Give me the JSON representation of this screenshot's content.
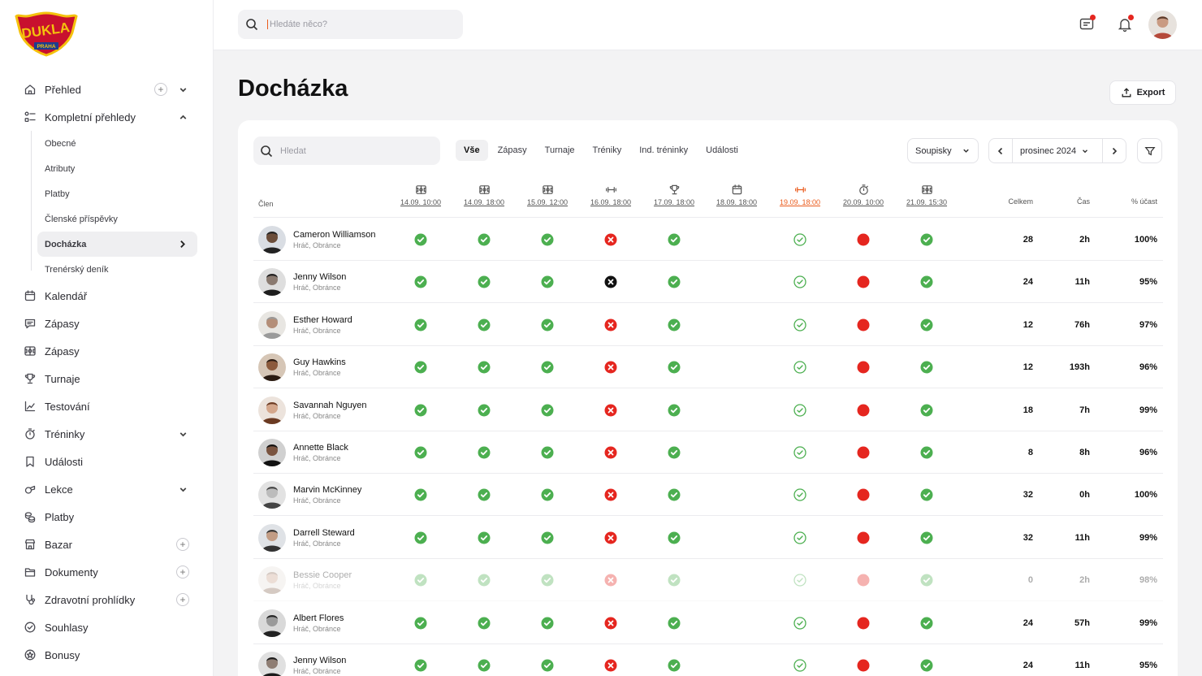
{
  "brand": {
    "logo_text": "DUKLA",
    "logo_sub": "PRAHA",
    "colors": {
      "accent": "#ea5b1c",
      "ok": "#4caf50",
      "bad": "#e5261f",
      "logo_red": "#c8102e",
      "logo_gold": "#f4c20d"
    }
  },
  "topbar": {
    "search_placeholder": "Hledáte něco?"
  },
  "sidebar": {
    "items": [
      {
        "label": "Přehled",
        "icon": "home-icon",
        "plus": true,
        "chevron": "down"
      },
      {
        "label": "Kompletní přehledy",
        "icon": "list-icon",
        "chevron": "up"
      },
      {
        "label": "Kalendář",
        "icon": "calendar-icon"
      },
      {
        "label": "Zápasy",
        "icon": "chat-icon"
      },
      {
        "label": "Zápasy",
        "icon": "pitch-icon"
      },
      {
        "label": "Turnaje",
        "icon": "trophy-icon"
      },
      {
        "label": "Testování",
        "icon": "chart-icon"
      },
      {
        "label": "Tréninky",
        "icon": "stopwatch-icon",
        "chevron": "down"
      },
      {
        "label": "Události",
        "icon": "bookmark-icon"
      },
      {
        "label": "Lekce",
        "icon": "whistle-icon",
        "chevron": "down"
      },
      {
        "label": "Platby",
        "icon": "coins-icon"
      },
      {
        "label": "Bazar",
        "icon": "store-icon",
        "plus": true
      },
      {
        "label": "Dokumenty",
        "icon": "folder-icon",
        "plus": true
      },
      {
        "label": "Zdravotní prohlídky",
        "icon": "stethoscope-icon",
        "plus": true
      },
      {
        "label": "Souhlasy",
        "icon": "check-circle-icon"
      },
      {
        "label": "Bonusy",
        "icon": "badge-icon"
      }
    ],
    "sub_items": [
      "Obecné",
      "Atributy",
      "Platby",
      "Členské příspěvky",
      "Docházka",
      "Trenérský deník"
    ]
  },
  "page": {
    "title": "Docházka",
    "export_label": "Export"
  },
  "toolbar": {
    "search_placeholder": "Hledat",
    "tabs": [
      "Vše",
      "Zápasy",
      "Turnaje",
      "Tréniky",
      "Ind. tréninky",
      "Události"
    ],
    "roster_label": "Soupisky",
    "month_label": "prosinec 2024"
  },
  "table": {
    "member_header": "Člen",
    "total_header": "Celkem",
    "time_header": "Čas",
    "pct_header": "% účast",
    "events": [
      {
        "date": "14.09. 10:00",
        "icon": "pitch-icon"
      },
      {
        "date": "14.09. 18:00",
        "icon": "pitch-icon"
      },
      {
        "date": "15.09. 12:00",
        "icon": "pitch-icon"
      },
      {
        "date": "16.09. 18:00",
        "icon": "dumbbell-icon"
      },
      {
        "date": "17.09. 18:00",
        "icon": "trophy-icon"
      },
      {
        "date": "18.09. 18:00",
        "icon": "calendar-icon"
      },
      {
        "date": "19.09. 18:00",
        "icon": "dumbbell-icon",
        "highlight": true
      },
      {
        "date": "20.09. 10:00",
        "icon": "stopwatch-icon"
      },
      {
        "date": "21.09. 15:30",
        "icon": "pitch-icon"
      }
    ],
    "status_legend": {
      "ok": "present",
      "x": "absent",
      "xk": "absent-black",
      "o": "planned",
      "r": "excused",
      "e": "empty"
    },
    "rows": [
      {
        "name": "Cameron Williamson",
        "role": "Hráč, Obránce",
        "statuses": [
          "ok",
          "ok",
          "ok",
          "x",
          "ok",
          "e",
          "o",
          "r",
          "ok"
        ],
        "total": "28",
        "time": "2h",
        "pct": "100%"
      },
      {
        "name": "Jenny Wilson",
        "role": "Hráč, Obránce",
        "statuses": [
          "ok",
          "ok",
          "ok",
          "xk",
          "ok",
          "e",
          "o",
          "r",
          "ok"
        ],
        "total": "24",
        "time": "11h",
        "pct": "95%"
      },
      {
        "name": "Esther Howard",
        "role": "Hráč, Obránce",
        "statuses": [
          "ok",
          "ok",
          "ok",
          "x",
          "ok",
          "e",
          "o",
          "r",
          "ok"
        ],
        "total": "12",
        "time": "76h",
        "pct": "97%"
      },
      {
        "name": "Guy Hawkins",
        "role": "Hráč, Obránce",
        "statuses": [
          "ok",
          "ok",
          "ok",
          "x",
          "ok",
          "e",
          "o",
          "r",
          "ok"
        ],
        "total": "12",
        "time": "193h",
        "pct": "96%"
      },
      {
        "name": "Savannah Nguyen",
        "role": "Hráč, Obránce",
        "statuses": [
          "ok",
          "ok",
          "ok",
          "x",
          "ok",
          "e",
          "o",
          "r",
          "ok"
        ],
        "total": "18",
        "time": "7h",
        "pct": "99%"
      },
      {
        "name": "Annette Black",
        "role": "Hráč, Obránce",
        "statuses": [
          "ok",
          "ok",
          "ok",
          "x",
          "ok",
          "e",
          "o",
          "r",
          "ok"
        ],
        "total": "8",
        "time": "8h",
        "pct": "96%"
      },
      {
        "name": "Marvin McKinney",
        "role": "Hráč, Obránce",
        "statuses": [
          "ok",
          "ok",
          "ok",
          "x",
          "ok",
          "e",
          "o",
          "r",
          "ok"
        ],
        "total": "32",
        "time": "0h",
        "pct": "100%"
      },
      {
        "name": "Darrell Steward",
        "role": "Hráč, Obránce",
        "statuses": [
          "ok",
          "ok",
          "ok",
          "x",
          "ok",
          "e",
          "o",
          "r",
          "ok"
        ],
        "total": "32",
        "time": "11h",
        "pct": "99%"
      },
      {
        "name": "Bessie Cooper",
        "role": "Hráč, Obránce",
        "dimmed": true,
        "statuses": [
          "ok",
          "ok",
          "ok",
          "x",
          "ok",
          "e",
          "o",
          "r",
          "ok"
        ],
        "total": "0",
        "time": "2h",
        "pct": "98%"
      },
      {
        "name": "Albert Flores",
        "role": "Hráč, Obránce",
        "statuses": [
          "ok",
          "ok",
          "ok",
          "x",
          "ok",
          "e",
          "o",
          "r",
          "ok"
        ],
        "total": "24",
        "time": "57h",
        "pct": "99%"
      },
      {
        "name": "Jenny Wilson",
        "role": "Hráč, Obránce",
        "statuses": [
          "ok",
          "ok",
          "ok",
          "x",
          "ok",
          "e",
          "o",
          "r",
          "ok"
        ],
        "total": "24",
        "time": "11h",
        "pct": "95%"
      }
    ]
  }
}
